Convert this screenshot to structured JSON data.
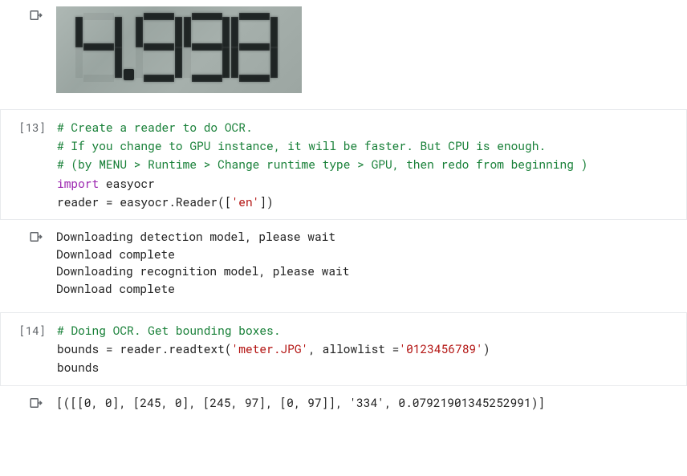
{
  "cells": {
    "img_out": {
      "lcd_value": "4,998"
    },
    "c13": {
      "exec_count": "[13]",
      "code": {
        "line1_comment": "# Create a reader to do OCR.",
        "line2_comment": "# If you change to GPU instance, it will be faster. But CPU is enough.",
        "line3_comment": "# (by MENU > Runtime > Change runtime type > GPU, then redo from beginning )",
        "line4_kw": "import",
        "line4_mod": " easyocr",
        "line5_pre": "reader = easyocr.Reader([",
        "line5_str": "'en'",
        "line5_post": "])"
      }
    },
    "c13_out": {
      "text": "Downloading detection model, please wait\nDownload complete\nDownloading recognition model, please wait\nDownload complete"
    },
    "c14": {
      "exec_count": "[14]",
      "code": {
        "line1_comment": "# Doing OCR. Get bounding boxes.",
        "line2_pre": "bounds = reader.readtext(",
        "line2_str1": "'meter.JPG'",
        "line2_mid": ", allowlist =",
        "line2_str2": "'0123456789'",
        "line2_post": ")",
        "line3": "bounds"
      }
    },
    "c14_out": {
      "text": "[([[0, 0], [245, 0], [245, 97], [0, 97]], '334', 0.07921901345252991)]"
    }
  }
}
